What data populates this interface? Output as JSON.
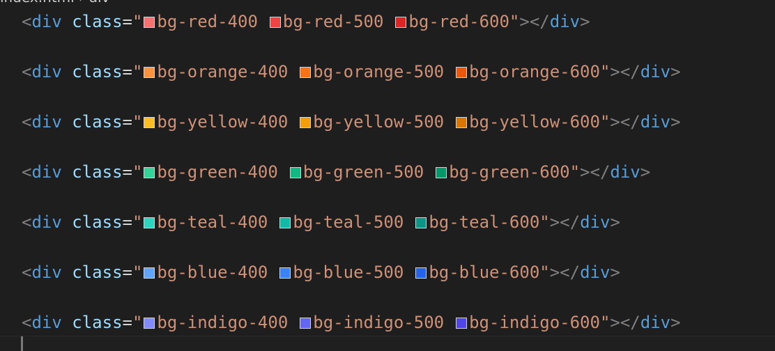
{
  "breadcrumb": {
    "file": "index.html",
    "separator": "›",
    "symbol": "div"
  },
  "code": {
    "tag_open": "<",
    "tag": "div",
    "attr": "class",
    "equals": "=",
    "quote": "\"",
    "close_tail": "\"></",
    "end": ">",
    "lines": [
      {
        "classes": [
          {
            "name": "bg-red-400",
            "color": "#f87171"
          },
          {
            "name": "bg-red-500",
            "color": "#ef4444"
          },
          {
            "name": "bg-red-600",
            "color": "#dc2626"
          }
        ]
      },
      {
        "classes": [
          {
            "name": "bg-orange-400",
            "color": "#fb923c"
          },
          {
            "name": "bg-orange-500",
            "color": "#f97316"
          },
          {
            "name": "bg-orange-600",
            "color": "#ea580c"
          }
        ]
      },
      {
        "classes": [
          {
            "name": "bg-yellow-400",
            "color": "#fbbf24"
          },
          {
            "name": "bg-yellow-500",
            "color": "#f59e0b"
          },
          {
            "name": "bg-yellow-600",
            "color": "#d97706"
          }
        ]
      },
      {
        "classes": [
          {
            "name": "bg-green-400",
            "color": "#34d399"
          },
          {
            "name": "bg-green-500",
            "color": "#10b981"
          },
          {
            "name": "bg-green-600",
            "color": "#059669"
          }
        ]
      },
      {
        "classes": [
          {
            "name": "bg-teal-400",
            "color": "#2dd4bf"
          },
          {
            "name": "bg-teal-500",
            "color": "#14b8a6"
          },
          {
            "name": "bg-teal-600",
            "color": "#0d9488"
          }
        ]
      },
      {
        "classes": [
          {
            "name": "bg-blue-400",
            "color": "#60a5fa"
          },
          {
            "name": "bg-blue-500",
            "color": "#3b82f6"
          },
          {
            "name": "bg-blue-600",
            "color": "#2563eb"
          }
        ]
      },
      {
        "classes": [
          {
            "name": "bg-indigo-400",
            "color": "#818cf8"
          },
          {
            "name": "bg-indigo-500",
            "color": "#6366f1"
          },
          {
            "name": "bg-indigo-600",
            "color": "#4f46e5"
          }
        ]
      }
    ]
  },
  "theme": {
    "background": "#1e1e1e",
    "tag_color": "#569cd6",
    "attr_color": "#9cdcfe",
    "string_color": "#ce9178",
    "bracket_color": "#808080"
  }
}
